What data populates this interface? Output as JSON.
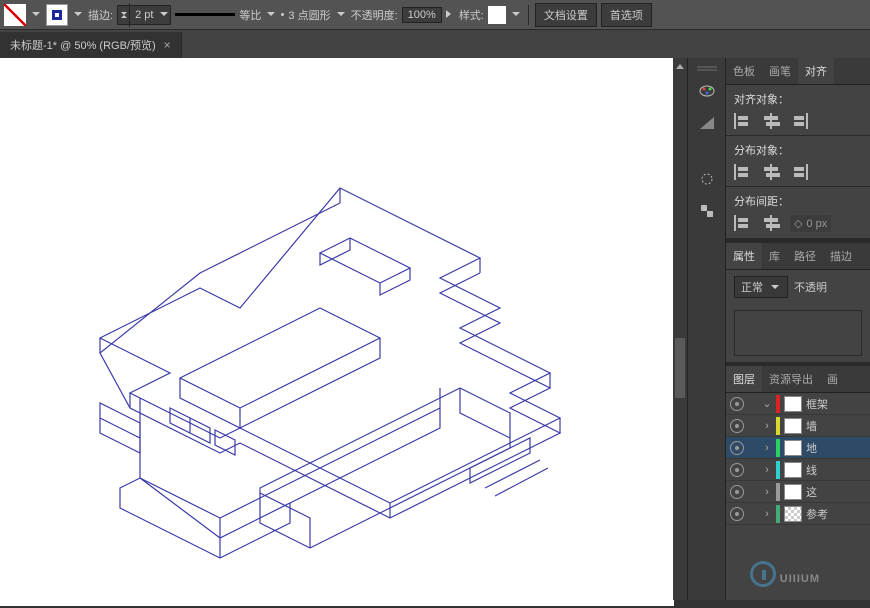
{
  "toolbar": {
    "stroke_label": "描边:",
    "stroke_weight": "2 pt",
    "stroke_profile": "等比",
    "brush_value": "3 点圆形",
    "opacity_label": "不透明度:",
    "opacity_value": "100%",
    "style_label": "样式:",
    "doc_setup": "文档设置",
    "prefs": "首选项"
  },
  "tab": {
    "title": "未标题-1* @ 50% (RGB/预览)",
    "close": "×"
  },
  "panels": {
    "tabs_row1": [
      "色板",
      "画笔",
      "对齐"
    ],
    "active_tab1": "对齐",
    "align": {
      "objects_hdr": "对齐对象：",
      "distribute_hdr": "分布对象：",
      "spacing_hdr": "分布间距：",
      "spacing_val": "0 px"
    },
    "tabs_row2": [
      "属性",
      "库",
      "路径",
      "描边"
    ],
    "blend_mode": "正常",
    "blend_opacity_label": "不透明",
    "tabs_row3": [
      "图层",
      "资源导出",
      "画"
    ],
    "layers": [
      {
        "name": "框架",
        "color": "#d22",
        "open": true,
        "sel": false
      },
      {
        "name": "墙",
        "color": "#d8d830",
        "open": false,
        "sel": false,
        "sub": true
      },
      {
        "name": "地",
        "color": "#2ad060",
        "open": false,
        "sel": true,
        "sub": true
      },
      {
        "name": "线",
        "color": "#30d0d0",
        "open": false,
        "sel": false,
        "sub": true
      },
      {
        "name": "这",
        "color": "#999",
        "open": false,
        "sel": false,
        "sub": true
      },
      {
        "name": "参考",
        "color": "#4a7",
        "open": false,
        "sel": false
      }
    ]
  },
  "watermark": "UIIIUM"
}
